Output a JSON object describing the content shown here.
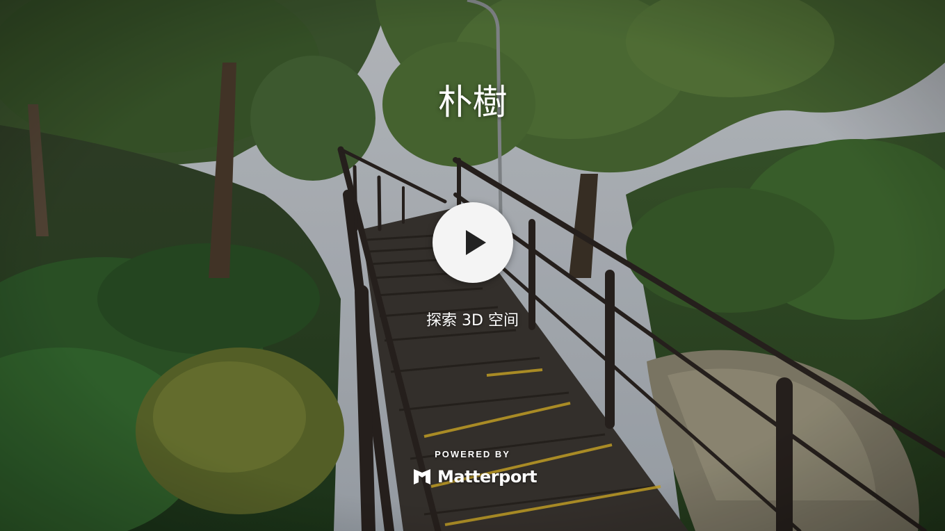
{
  "viewer": {
    "title": "朴樹",
    "explore_label": "探索 3D 空间",
    "powered_by": "POWERED BY",
    "brand_name": "Matterport"
  },
  "icons": {
    "play": "play-icon",
    "brand_logo": "matterport-logo-icon"
  },
  "colors": {
    "play_button_bg": "#f4f4f4",
    "play_icon": "#222222",
    "text": "#ffffff",
    "stair_edge_stripe": "#d9b22a"
  }
}
